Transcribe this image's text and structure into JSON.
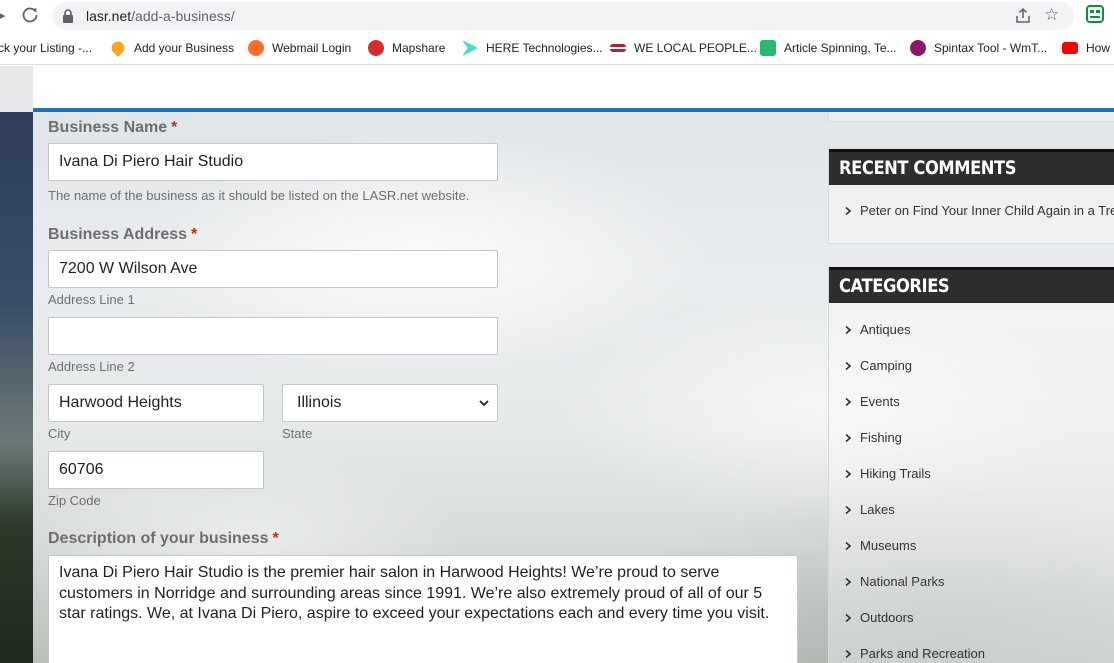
{
  "browser": {
    "url_host": "lasr.net",
    "url_path": "/add-a-business/",
    "bookmarks": [
      "ck your Listing -...",
      "Add your Business",
      "Webmail Login",
      "Mapshare",
      "HERE Technologies...",
      "WE LOCAL PEOPLE...",
      "Article Spinning, Te...",
      "Spintax Tool - WmT...",
      "How"
    ]
  },
  "form": {
    "business_name": {
      "label": "Business Name",
      "required_mark": "*",
      "value": "Ivana Di Piero Hair Studio",
      "help": "The name of the business as it should be listed on the LASR.net website."
    },
    "address": {
      "label": "Business Address",
      "required_mark": "*",
      "line1_value": "7200 W Wilson Ave",
      "line1_label": "Address Line 1",
      "line2_value": "",
      "line2_label": "Address Line 2",
      "city_value": "Harwood Heights",
      "city_label": "City",
      "state_value": "Illinois",
      "state_label": "State",
      "zip_value": "60706",
      "zip_label": "Zip Code"
    },
    "description": {
      "label": "Description of your business",
      "required_mark": "*",
      "lines": [
        "Ivana Di Piero Hair Studio is the premier hair salon in Harwood Heights! We’re proud to serve",
        "customers in Norridge and surrounding areas since 1991. We’re also extremely proud of all of our 5",
        "star ratings. We, at Ivana Di Piero, aspire to exceed your expectations each and every time you visit."
      ]
    }
  },
  "sidebar": {
    "recent_comments": {
      "title": "RECENT COMMENTS",
      "items": [
        "Peter on Find Your Inner Child Again in a Tre"
      ]
    },
    "categories": {
      "title": "CATEGORIES",
      "items": [
        "Antiques",
        "Camping",
        "Events",
        "Fishing",
        "Hiking Trails",
        "Lakes",
        "Museums",
        "National Parks",
        "Outdoors",
        "Parks and Recreation"
      ]
    }
  },
  "colors": {
    "accent_blue": "#1e73be",
    "required_red": "#c02b0a",
    "widget_header": "#2e2e2e"
  }
}
